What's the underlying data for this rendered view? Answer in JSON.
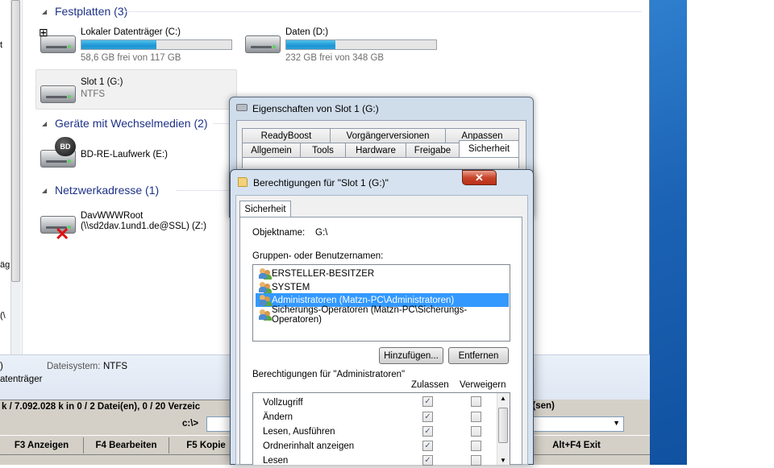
{
  "left_sliver": {
    "texts": [
      "t",
      "äg",
      "(\\"
    ]
  },
  "explorer": {
    "groups": [
      {
        "label": "Festplatten (3)"
      },
      {
        "label": "Geräte mit Wechselmedien (2)"
      },
      {
        "label": "Netzwerkadresse (1)"
      }
    ],
    "drives": [
      {
        "name": "Lokaler Datenträger (C:)",
        "sub": "58,6 GB frei von 117 GB",
        "used_fraction": 0.5
      },
      {
        "name": "Daten (D:)",
        "sub": "232 GB frei von 348 GB",
        "used_fraction": 0.33
      },
      {
        "name": "Slot 1 (G:)",
        "sub": "NTFS"
      },
      {
        "name": "BD-RE-Laufwerk (E:)",
        "logo": "BD"
      },
      {
        "name": "DavWWWRoot",
        "sub": "(\\\\sd2dav.1und1.de@SSL) (Z:)"
      }
    ],
    "details": {
      "fs_label": "Dateisystem:",
      "fs_value": "NTFS",
      "left1": ")",
      "left2": "atenträger"
    }
  },
  "tc": {
    "status_left": "k / 7.092.028 k in 0 / 2 Datei(en), 0 / 20 Verzeic",
    "status_right": "s(sen)",
    "path": "c:\\>",
    "keys": [
      "F3 Anzeigen",
      "F4 Bearbeiten",
      "F5 Kopie",
      "Alt+F4 Exit"
    ]
  },
  "props": {
    "title": "Eigenschaften von Slot 1 (G:)",
    "tabs_row1": [
      "ReadyBoost",
      "Vorgängerversionen",
      "Anpassen"
    ],
    "tabs_row2": [
      "Allgemein",
      "Tools",
      "Hardware",
      "Freigabe",
      "Sicherheit"
    ]
  },
  "perm": {
    "title": "Berechtigungen für \"Slot 1 (G:)\"",
    "tab": "Sicherheit",
    "object_label": "Objektname:",
    "object_value": "G:\\",
    "groups_label": "Gruppen- oder Benutzernamen:",
    "users": [
      "ERSTELLER-BESITZER",
      "SYSTEM",
      "Administratoren (Matzn-PC\\Administratoren)",
      "Sicherungs-Operatoren (Matzn-PC\\Sicherungs-Operatoren)"
    ],
    "selected_user_index": 2,
    "add_button": "Hinzufügen...",
    "remove_button": "Entfernen",
    "perms_label": "Berechtigungen für \"Administratoren\"",
    "col_allow": "Zulassen",
    "col_deny": "Verweigern",
    "permissions": [
      {
        "name": "Vollzugriff",
        "allow": true,
        "deny": false
      },
      {
        "name": "Ändern",
        "allow": true,
        "deny": false
      },
      {
        "name": "Lesen, Ausführen",
        "allow": true,
        "deny": false
      },
      {
        "name": "Ordnerinhalt anzeigen",
        "allow": true,
        "deny": false
      },
      {
        "name": "Lesen",
        "allow": true,
        "deny": false
      }
    ],
    "close_glyph": "✕"
  },
  "icons": [
    "drive-icon",
    "bluray-drive-icon",
    "network-drive-disconnected-icon",
    "user-group-icon",
    "folder-icon",
    "close-icon",
    "checkbox-icon"
  ]
}
